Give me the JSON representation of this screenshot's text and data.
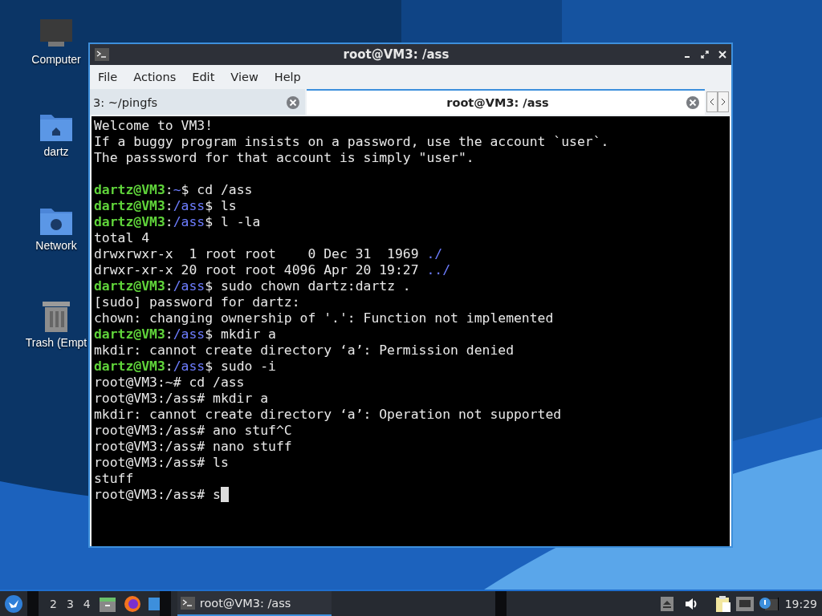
{
  "desktop_icons": [
    {
      "label": "Computer",
      "kind": "computer"
    },
    {
      "label": "dartz",
      "kind": "home"
    },
    {
      "label": "Network",
      "kind": "network"
    },
    {
      "label": "Trash (Empt",
      "kind": "trash"
    }
  ],
  "window": {
    "title": "root@VM3: /ass",
    "menu": [
      "File",
      "Actions",
      "Edit",
      "View",
      "Help"
    ],
    "tabs": [
      {
        "label": "3: ~/pingfs",
        "selected": false
      },
      {
        "label": "root@VM3: /ass",
        "selected": true
      }
    ],
    "terminal": {
      "lines": [
        [
          {
            "kind": "plain",
            "text": "Welcome to VM3!"
          }
        ],
        [
          {
            "kind": "plain",
            "text": "If a buggy program insists on a password, use the account `user`."
          }
        ],
        [
          {
            "kind": "plain",
            "text": "The passsword for that account is simply \"user\"."
          }
        ],
        [
          {
            "kind": "blank"
          }
        ],
        [
          {
            "kind": "user",
            "text": "dartz@VM3"
          },
          {
            "kind": "plain",
            "text": ":"
          },
          {
            "kind": "path",
            "text": "~"
          },
          {
            "kind": "plain",
            "text": "$ cd /ass"
          }
        ],
        [
          {
            "kind": "user",
            "text": "dartz@VM3"
          },
          {
            "kind": "plain",
            "text": ":"
          },
          {
            "kind": "path",
            "text": "/ass"
          },
          {
            "kind": "plain",
            "text": "$ ls"
          }
        ],
        [
          {
            "kind": "user",
            "text": "dartz@VM3"
          },
          {
            "kind": "plain",
            "text": ":"
          },
          {
            "kind": "path",
            "text": "/ass"
          },
          {
            "kind": "plain",
            "text": "$ l -la"
          }
        ],
        [
          {
            "kind": "plain",
            "text": "total 4"
          }
        ],
        [
          {
            "kind": "plain",
            "text": "drwxrwxr-x  1 root root    0 Dec 31  1969 "
          },
          {
            "kind": "path",
            "text": "./"
          }
        ],
        [
          {
            "kind": "plain",
            "text": "drwxr-xr-x 20 root root 4096 Apr 20 19:27 "
          },
          {
            "kind": "path",
            "text": "../"
          }
        ],
        [
          {
            "kind": "user",
            "text": "dartz@VM3"
          },
          {
            "kind": "plain",
            "text": ":"
          },
          {
            "kind": "path",
            "text": "/ass"
          },
          {
            "kind": "plain",
            "text": "$ sudo chown dartz:dartz ."
          }
        ],
        [
          {
            "kind": "plain",
            "text": "[sudo] password for dartz:"
          }
        ],
        [
          {
            "kind": "plain",
            "text": "chown: changing ownership of '.': Function not implemented"
          }
        ],
        [
          {
            "kind": "user",
            "text": "dartz@VM3"
          },
          {
            "kind": "plain",
            "text": ":"
          },
          {
            "kind": "path",
            "text": "/ass"
          },
          {
            "kind": "plain",
            "text": "$ mkdir a"
          }
        ],
        [
          {
            "kind": "plain",
            "text": "mkdir: cannot create directory ‘a’: Permission denied"
          }
        ],
        [
          {
            "kind": "user",
            "text": "dartz@VM3"
          },
          {
            "kind": "plain",
            "text": ":"
          },
          {
            "kind": "path",
            "text": "/ass"
          },
          {
            "kind": "plain",
            "text": "$ sudo -i"
          }
        ],
        [
          {
            "kind": "plain",
            "text": "root@VM3:~# cd /ass"
          }
        ],
        [
          {
            "kind": "plain",
            "text": "root@VM3:/ass# mkdir a"
          }
        ],
        [
          {
            "kind": "plain",
            "text": "mkdir: cannot create directory ‘a’: Operation not supported"
          }
        ],
        [
          {
            "kind": "plain",
            "text": "root@VM3:/ass# ano stuf^C"
          }
        ],
        [
          {
            "kind": "plain",
            "text": "root@VM3:/ass# nano stuff"
          }
        ],
        [
          {
            "kind": "plain",
            "text": "root@VM3:/ass# ls"
          }
        ],
        [
          {
            "kind": "plain",
            "text": "stuff"
          }
        ],
        [
          {
            "kind": "plain",
            "text": "root@VM3:/ass# s"
          },
          {
            "kind": "cursor"
          }
        ]
      ]
    }
  },
  "taskbar": {
    "workspaces": [
      "2",
      "3",
      "4"
    ],
    "task": "root@VM3: /ass",
    "clock": "19:29"
  }
}
